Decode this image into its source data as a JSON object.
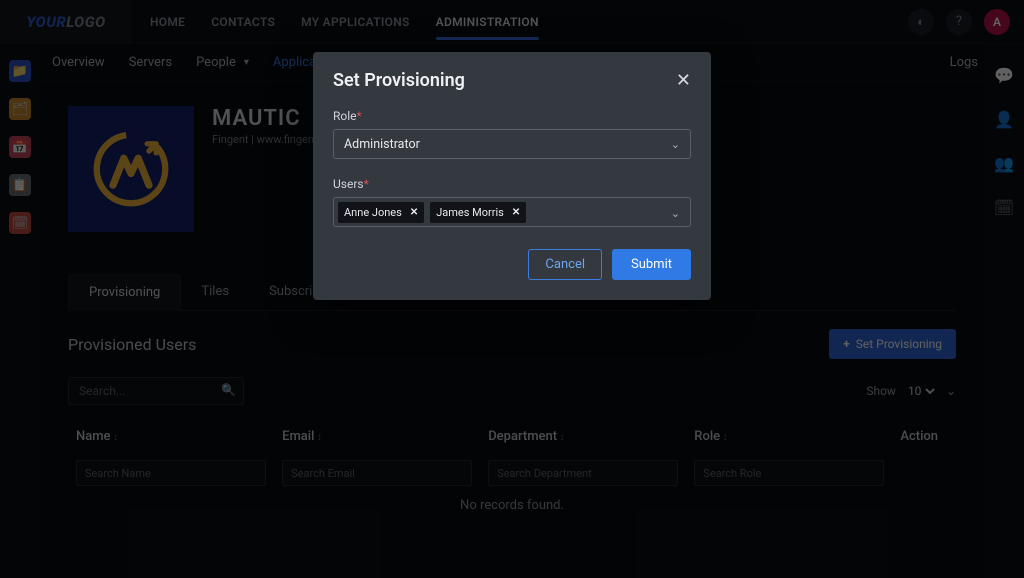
{
  "brand": {
    "a": "YOUR",
    "b": " LOGO"
  },
  "topnav": {
    "items": [
      "HOME",
      "CONTACTS",
      "MY APPLICATIONS",
      "ADMINISTRATION"
    ],
    "active_index": 3,
    "avatar_initial": "A"
  },
  "subnav": {
    "items": [
      {
        "label": "Overview"
      },
      {
        "label": "Servers"
      },
      {
        "label": "People",
        "dropdown": true
      },
      {
        "label": "Applications",
        "active": true
      },
      {
        "label": "Logs"
      }
    ]
  },
  "app": {
    "title": "MAUTIC",
    "subtitle": "Fingent | www.fingent.com"
  },
  "tabs": {
    "items": [
      "Provisioning",
      "Tiles",
      "Subscription"
    ],
    "active_index": 0
  },
  "panel": {
    "title": "Provisioned Users",
    "set_button": "Set Provisioning",
    "search_placeholder": "Search...",
    "show_label": "Show",
    "show_value": "10",
    "columns": [
      "Name",
      "Email",
      "Department",
      "Role",
      "Action"
    ],
    "filter_placeholders": [
      "Search Name",
      "Search Email",
      "Search Department",
      "Search Role"
    ],
    "empty_text": "No records found."
  },
  "modal": {
    "title": "Set Provisioning",
    "role_label": "Role",
    "role_value": "Administrator",
    "users_label": "Users",
    "user_chips": [
      "Anne Jones",
      "James Morris"
    ],
    "cancel": "Cancel",
    "submit": "Submit"
  }
}
